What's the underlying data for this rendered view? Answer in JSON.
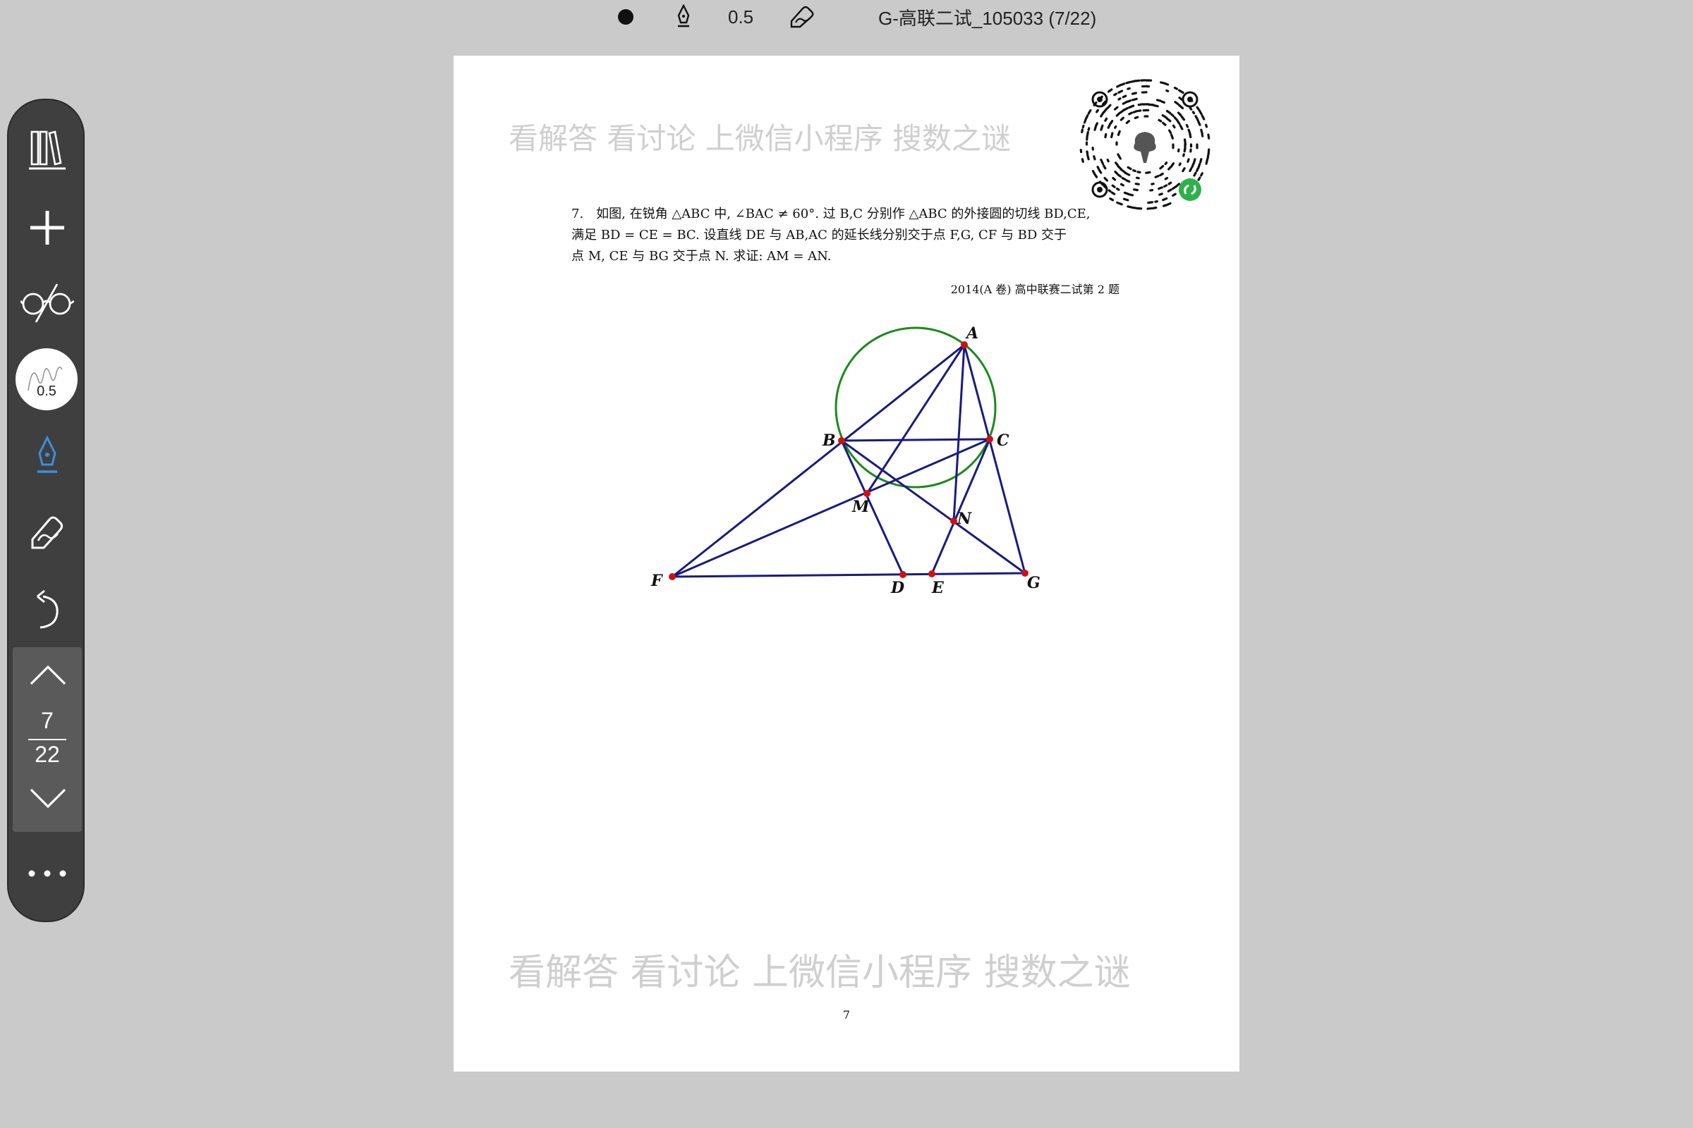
{
  "toolbar": {
    "pen_width": "0.5",
    "document_title": "G-高联二试_105033 (7/22)"
  },
  "sidebar": {
    "pen_width": "0.5",
    "current_page": "7",
    "total_pages": "22"
  },
  "page": {
    "watermark_top": "看解答 看讨论 上微信小程序 搜数之谜",
    "watermark_bottom": "看解答 看讨论 上微信小程序 搜数之谜",
    "problem_lines": [
      "7.　如图, 在锐角 △ABC 中, ∠BAC ≠ 60°. 过 B,C 分别作 △ABC 的外接圆的切线 BD,CE,",
      "满足 BD = CE = BC. 设直线 DE 与 AB,AC 的延长线分别交于点 F,G, CF 与 BD 交于",
      "点 M, CE 与 BG 交于点 N. 求证: AM = AN."
    ],
    "source": "2014(A 卷) 高中联赛二试第 2 题",
    "page_number": "7",
    "diagram_labels": {
      "A": "A",
      "B": "B",
      "C": "C",
      "M": "M",
      "N": "N",
      "F": "F",
      "D": "D",
      "E": "E",
      "G": "G"
    }
  },
  "colors": {
    "circle": "#1a8a1a",
    "lines": "#1a1a80",
    "points": "#d01010",
    "active_pen": "#3a8fe0"
  }
}
